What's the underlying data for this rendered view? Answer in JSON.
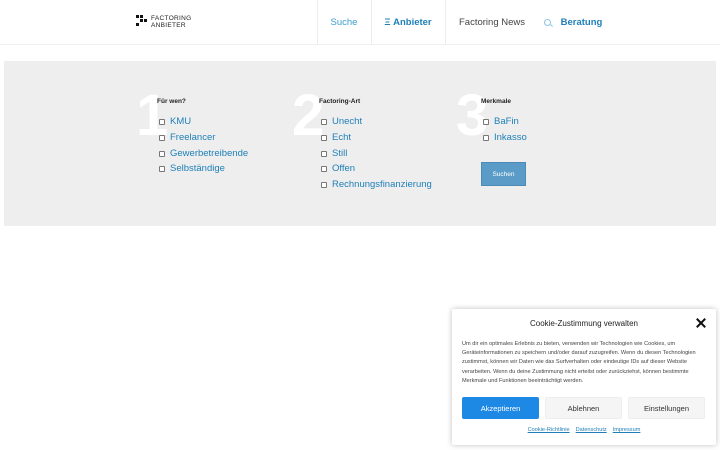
{
  "logo": {
    "line1": "FACTORING",
    "line2": "ANBIETER"
  },
  "nav": {
    "suche": "Suche",
    "anbieter": "Ξ Anbieter",
    "news": "Factoring News",
    "beratung": "Beratung"
  },
  "filters": [
    {
      "number": "1",
      "title": "Für wen?",
      "options": [
        "KMU",
        "Freelancer",
        "Gewerbetreibende",
        "Selbständige"
      ]
    },
    {
      "number": "2",
      "title": "Factoring-Art",
      "options": [
        "Unecht",
        "Echt",
        "Still",
        "Offen",
        "Rechnungsfinanzierung"
      ]
    },
    {
      "number": "3",
      "title": "Merkmale",
      "options": [
        "BaFin",
        "Inkasso"
      ]
    }
  ],
  "search_button": "Suchen",
  "cookie": {
    "title": "Cookie-Zustimmung verwalten",
    "text": "Um dir ein optimales Erlebnis zu bieten, verwenden wir Technologien wie Cookies, um Geräteinformationen zu speichern und/oder darauf zuzugreifen. Wenn du diesen Technologien zustimmst, können wir Daten wie das Surfverhalten oder eindeutige IDs auf dieser Website verarbeiten. Wenn du deine Zustimmung nicht erteilst oder zurückziehst, können bestimmte Merkmale und Funktionen beeinträchtigt werden.",
    "accept": "Akzeptieren",
    "deny": "Ablehnen",
    "settings": "Einstellungen",
    "links": [
      "Cookie-Richtlinie",
      "Datenschutz",
      "Impressum"
    ]
  }
}
